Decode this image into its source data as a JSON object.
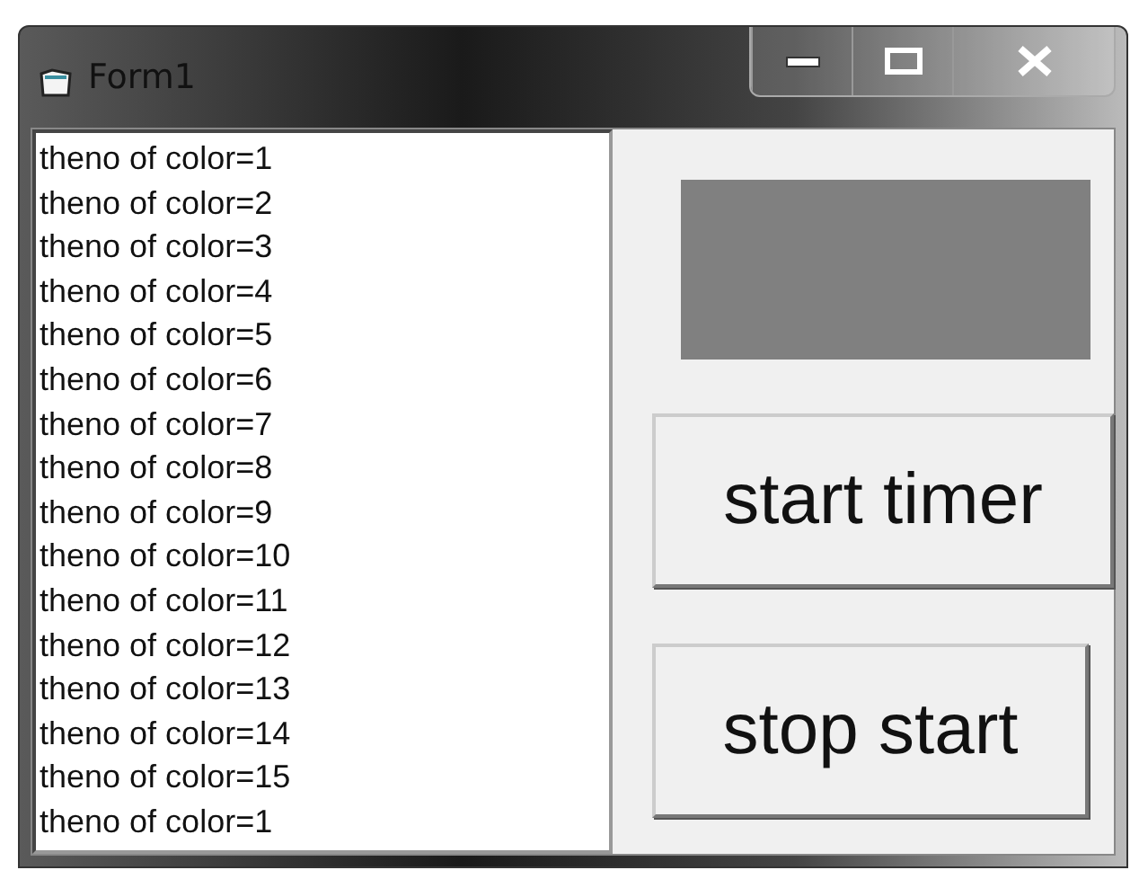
{
  "window": {
    "title": "Form1"
  },
  "list_items": [
    "theno of color=1",
    "theno of color=2",
    "theno of color=3",
    "theno of color=4",
    "theno of color=5",
    "theno of color=6",
    "theno of color=7",
    "theno of color=8",
    "theno of color=9",
    "theno of color=10",
    "theno of color=11",
    "theno of color=12",
    "theno of color=13",
    "theno of color=14",
    "theno of color=15",
    "theno of color=1"
  ],
  "buttons": [
    {
      "label": "start timer"
    },
    {
      "label": "stop start"
    }
  ]
}
